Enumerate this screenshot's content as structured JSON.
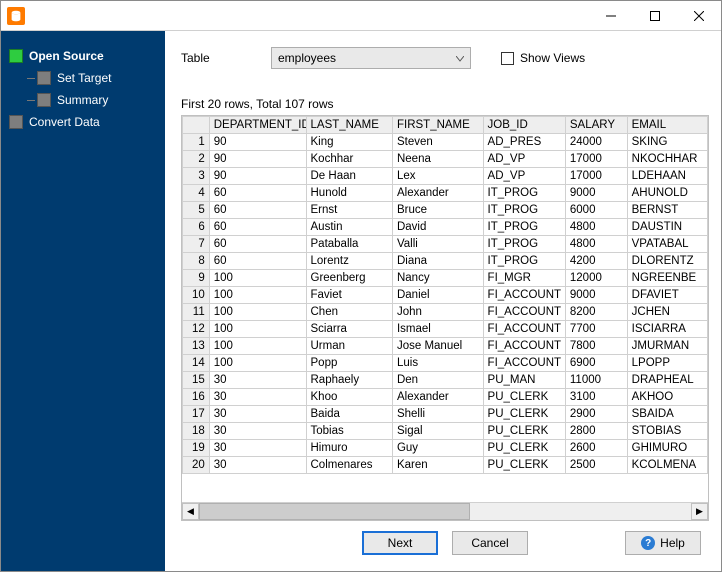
{
  "sidebar": {
    "items": [
      {
        "label": "Open Source",
        "active": true
      },
      {
        "label": "Set Target",
        "active": false
      },
      {
        "label": "Summary",
        "active": false
      },
      {
        "label": "Convert Data",
        "active": false
      }
    ]
  },
  "form": {
    "table_label": "Table",
    "table_selected": "employees",
    "show_views_label": "Show Views"
  },
  "count_text": "First 20 rows, Total 107 rows",
  "table": {
    "columns": [
      "DEPARTMENT_ID",
      "LAST_NAME",
      "FIRST_NAME",
      "JOB_ID",
      "SALARY",
      "EMAIL"
    ],
    "rows": [
      [
        "90",
        "King",
        "Steven",
        "AD_PRES",
        "24000",
        "SKING"
      ],
      [
        "90",
        "Kochhar",
        "Neena",
        "AD_VP",
        "17000",
        "NKOCHHAR"
      ],
      [
        "90",
        "De Haan",
        "Lex",
        "AD_VP",
        "17000",
        "LDEHAAN"
      ],
      [
        "60",
        "Hunold",
        "Alexander",
        "IT_PROG",
        "9000",
        "AHUNOLD"
      ],
      [
        "60",
        "Ernst",
        "Bruce",
        "IT_PROG",
        "6000",
        "BERNST"
      ],
      [
        "60",
        "Austin",
        "David",
        "IT_PROG",
        "4800",
        "DAUSTIN"
      ],
      [
        "60",
        "Pataballa",
        "Valli",
        "IT_PROG",
        "4800",
        "VPATABAL"
      ],
      [
        "60",
        "Lorentz",
        "Diana",
        "IT_PROG",
        "4200",
        "DLORENTZ"
      ],
      [
        "100",
        "Greenberg",
        "Nancy",
        "FI_MGR",
        "12000",
        "NGREENBE"
      ],
      [
        "100",
        "Faviet",
        "Daniel",
        "FI_ACCOUNT",
        "9000",
        "DFAVIET"
      ],
      [
        "100",
        "Chen",
        "John",
        "FI_ACCOUNT",
        "8200",
        "JCHEN"
      ],
      [
        "100",
        "Sciarra",
        "Ismael",
        "FI_ACCOUNT",
        "7700",
        "ISCIARRA"
      ],
      [
        "100",
        "Urman",
        "Jose Manuel",
        "FI_ACCOUNT",
        "7800",
        "JMURMAN"
      ],
      [
        "100",
        "Popp",
        "Luis",
        "FI_ACCOUNT",
        "6900",
        "LPOPP"
      ],
      [
        "30",
        "Raphaely",
        "Den",
        "PU_MAN",
        "11000",
        "DRAPHEAL"
      ],
      [
        "30",
        "Khoo",
        "Alexander",
        "PU_CLERK",
        "3100",
        "AKHOO"
      ],
      [
        "30",
        "Baida",
        "Shelli",
        "PU_CLERK",
        "2900",
        "SBAIDA"
      ],
      [
        "30",
        "Tobias",
        "Sigal",
        "PU_CLERK",
        "2800",
        "STOBIAS"
      ],
      [
        "30",
        "Himuro",
        "Guy",
        "PU_CLERK",
        "2600",
        "GHIMURO"
      ],
      [
        "30",
        "Colmenares",
        "Karen",
        "PU_CLERK",
        "2500",
        "KCOLMENA"
      ]
    ]
  },
  "buttons": {
    "next": "Next",
    "cancel": "Cancel",
    "help": "Help"
  }
}
